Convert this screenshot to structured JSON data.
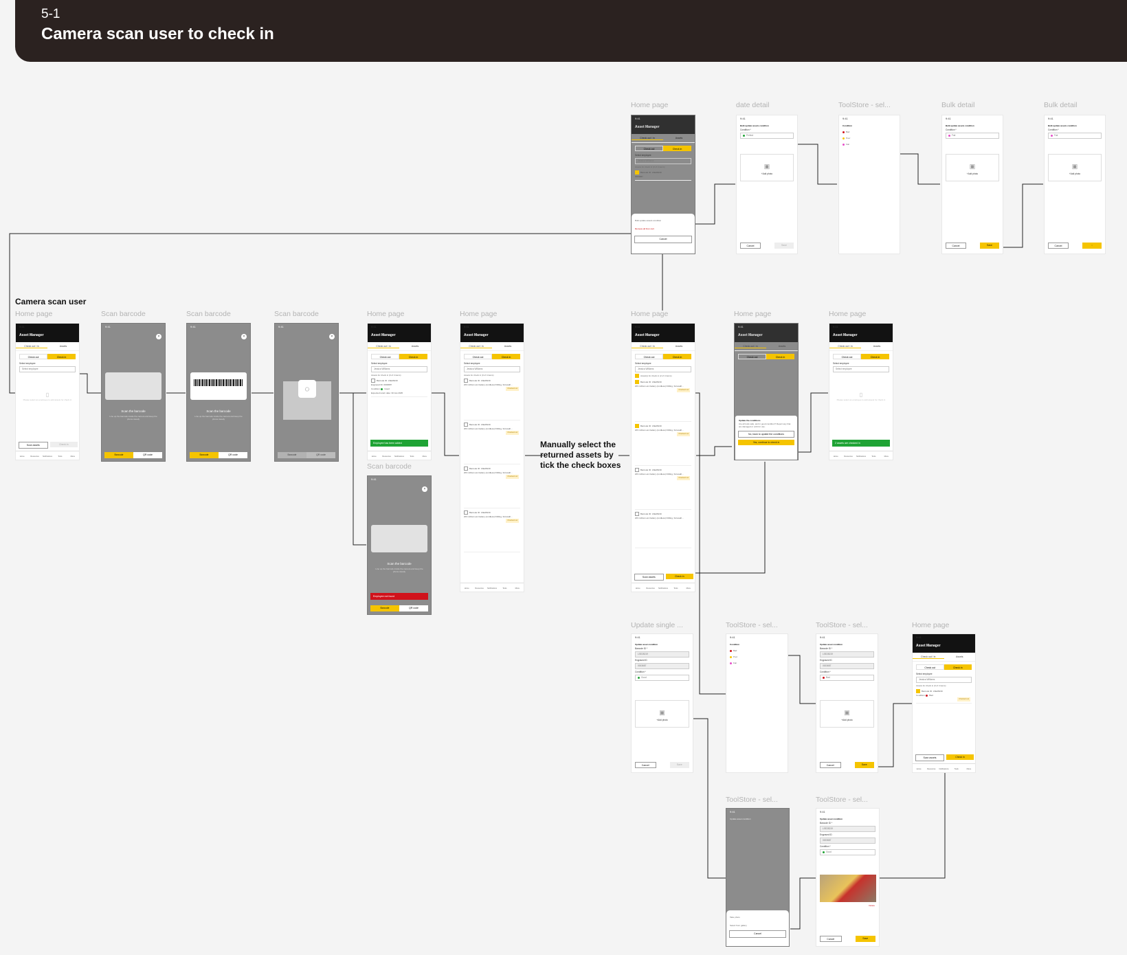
{
  "banner": {
    "code": "5-1",
    "title": "Camera scan user to check in"
  },
  "section_label": "Camera scan user",
  "note": "Manually select the returned assets by tick the check boxes",
  "frame_labels": {
    "home_page": "Home page",
    "scan_barcode": "Scan barcode",
    "date_detail": "date detail",
    "toolstore_select": "ToolStore - sel...",
    "bulk_detail": "Bulk detail",
    "update_single": "Update single ..."
  },
  "app": {
    "status_time": "9:41",
    "header_title": "Asset Manager",
    "menu_icon": "more-vertical-icon",
    "tab_checkout_in": "Check out / in",
    "tab_assets": "Assets",
    "seg_check_out": "Check out",
    "seg_check_in": "Check in",
    "select_employee_label": "Select employee",
    "select_employee_placeholder": "Select employee",
    "employee_name": "Jessica Williams",
    "assets_for_checkin": "Assets for check in (0 of 4 items)",
    "assets_selected": "Asset(s) for check in (2 of 4 items)",
    "empty_hint": "Please select an employee to add assets for check in",
    "scan_assets": "Scan assets",
    "check_in_btn": "Check in",
    "nav": [
      "Home",
      "Resources",
      "Notifications",
      "Tools",
      "Menu"
    ]
  },
  "asset_card": {
    "barcode_label": "Barcode ID:",
    "barcode_value": "LSE28219",
    "engraved_label": "Engraved ID:",
    "engraved_value": "0003687",
    "description_label": "Description:",
    "description_value": "20V Lithium-ion battery (cordless) Drilling, Screwdri...",
    "condition_label": "Condition:",
    "condition_good": "Good",
    "condition_bad": "Bad",
    "return_label": "Expected return date:",
    "return_value": "30 Jan 2025",
    "status_pill": "Checked out"
  },
  "scan": {
    "title": "Scan the barcode",
    "subtitle": "Line up the barcode inside the camera and keep the phone steady",
    "barcode_tab": "Barcode",
    "qr_tab": "QR code",
    "close_icon": "close-icon"
  },
  "toasts": {
    "employee_added": "Employee has been added",
    "employee_not_found": "Employee not found",
    "assets_checked_in": "2 assets are checked in"
  },
  "sheet": {
    "bulk_update": "Bulk update assets condition",
    "remove_all": "Remove all from cart",
    "cancel": "Cancel",
    "take_photo": "Take photo",
    "select_gallery": "Select from gallery"
  },
  "dialog": {
    "title": "Update the conditions",
    "body": "Are all tools safe, and in good condition? Report any that are damaged or unfit for use.",
    "no_btn": "No, back to update the conditions",
    "yes_btn": "Yes, continue to check in"
  },
  "condition": {
    "bulk_title": "Bulk update assets condition",
    "single_title": "Update asset condition",
    "picker_title": "Condition",
    "condition_field_label": "Condition *",
    "barcode_field_label": "Barcode ID *",
    "engraved_field_label": "Engraved ID",
    "perfect": "Perfect",
    "fair": "Fair",
    "bad": "Bad",
    "poor": "Poor",
    "good": "Good",
    "add_photo": "+Add photo",
    "cancel": "Cancel",
    "save": "Save",
    "delete": "Delete"
  },
  "colors": {
    "accent": "#f5c400",
    "banner": "#2b2220",
    "success": "#1fa335",
    "error": "#d0121b",
    "bad": "#d0121b",
    "good": "#1fa335",
    "fair": "#e64fc9",
    "poor": "#f5c400"
  }
}
